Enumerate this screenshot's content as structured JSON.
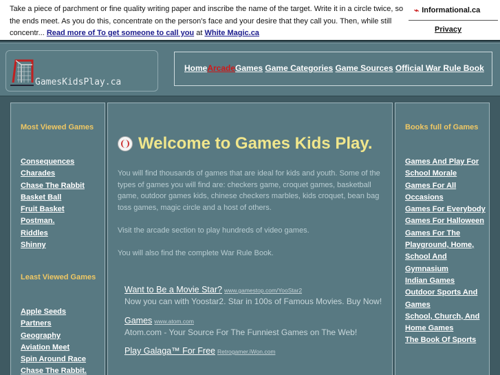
{
  "ad_bar": {
    "text": "Take a piece of parchment or fine quality writing paper and inscribe the name of the target. Write it in a circle twice, so the ends meet. As you do this, concentrate on the person's face and your desire that they call you. Then, while still concentr...",
    "read_more_link": "Read more of To get someone to call you",
    "at_word": "at",
    "source_link": "White Magic.ca",
    "brand": "Informational.ca",
    "brand_icon": "informational-logo-icon",
    "privacy": "Privacy"
  },
  "header": {
    "logo_text": "GamesKidsPlay.ca",
    "logo_icon": "hockey-net-icon",
    "nav": [
      {
        "label": "Home",
        "active": false
      },
      {
        "label": "Arcade",
        "active": true
      },
      {
        "label": "Games",
        "active": false
      },
      {
        "label": "Game Categories",
        "active": false
      },
      {
        "label": "Game Sources",
        "active": false
      },
      {
        "label": "Official War Rule Book",
        "active": false
      }
    ]
  },
  "left": {
    "most_viewed_title": "Most Viewed Games",
    "most_viewed": [
      "Consequences",
      "Charades",
      "Chase The Rabbit",
      "Basket Ball",
      "Fruit Basket",
      "Postman.",
      "Riddles",
      "Shinny"
    ],
    "least_viewed_title": "Least Viewed Games",
    "least_viewed": [
      "Apple Seeds",
      "Partners",
      "Geography",
      "Aviation Meet",
      "Spin Around Race",
      "Chase The Rabbit."
    ]
  },
  "main": {
    "welcome_icon": "baseball-icon",
    "welcome": "Welcome to Games Kids Play.",
    "intro": [
      "You will find thousands of games that are ideal for kids and youth. Some of the types of games you will find are: checkers game, croquet games, basketball game, outdoor games kids, chinese checkers marbles, kids croquet, bean bag toss games, magic circle and a host of others.",
      "Visit the arcade section to play hundreds of video games.",
      "You will also find the complete War Rule Book."
    ],
    "ads": [
      {
        "title": "Want to Be a Movie Star?",
        "url": "www.gamestop.com/YooStar2",
        "desc": "Now you can with Yoostar2. Star in 100s of Famous Movies. Buy Now!"
      },
      {
        "title": "Games",
        "url": "www.atom.com",
        "desc": "Atom.com - Your Source For The Funniest Games on The Web!"
      },
      {
        "title": "Play Galaga™ For Free",
        "url": "Retrogamer.iWon.com",
        "desc": ""
      }
    ]
  },
  "right": {
    "title": "Books full of Games",
    "books": [
      "Games And Play For School Morale",
      "Games For All Occasions",
      "Games For Everybody",
      "Games For Halloween",
      "Games For The Playground, Home, School And Gymnasium",
      "Indian Games",
      "Outdoor Sports And Games",
      "School, Church, And Home Games",
      "The Book Of Sports"
    ]
  }
}
